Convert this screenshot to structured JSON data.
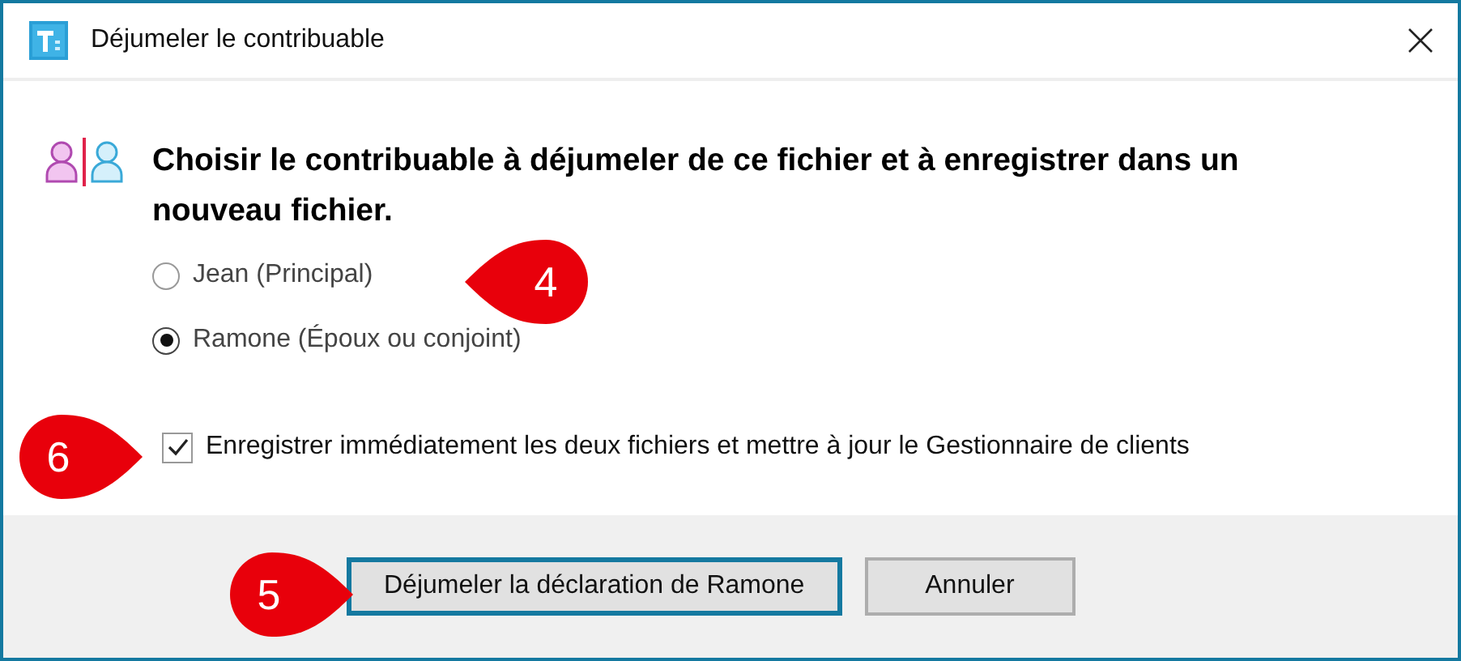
{
  "window": {
    "title": "Déjumeler le contribuable"
  },
  "heading": "Choisir le contribuable à déjumeler de ce fichier et à enregistrer dans un nouveau fichier.",
  "options": [
    {
      "label": "Jean (Principal)",
      "selected": false
    },
    {
      "label": "Ramone (Époux ou conjoint)",
      "selected": true
    }
  ],
  "save_checkbox": {
    "label": "Enregistrer immédiatement les deux fichiers et mettre à jour le Gestionnaire de clients",
    "checked": true
  },
  "buttons": [
    {
      "label": "Déjumeler la déclaration de Ramone",
      "kind": "primary"
    },
    {
      "label": "Annuler",
      "kind": "secondary"
    }
  ],
  "callouts": [
    {
      "label": "4",
      "kind": "left"
    },
    {
      "label": "6",
      "kind": "right"
    },
    {
      "label": "5",
      "kind": "right"
    }
  ]
}
